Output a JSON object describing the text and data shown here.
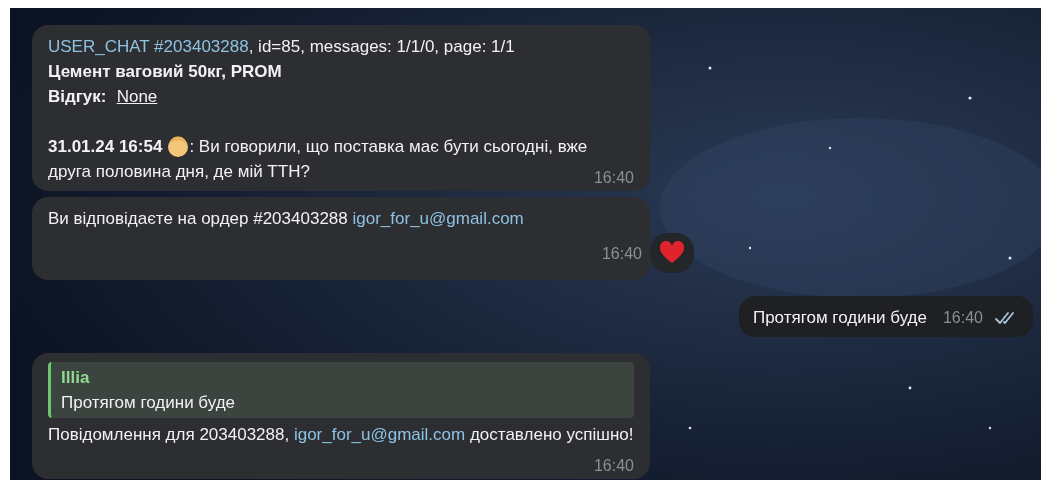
{
  "messages": [
    {
      "kind": "incoming",
      "blocks": [
        [
          [
            {
              "kind": "link",
              "text": "USER_CHAT #203403288"
            },
            {
              "kind": "text",
              "text": ", id=85, messages: 1/1/0, page: 1/1"
            }
          ],
          [
            {
              "kind": "bold",
              "text": "Цемент ваговий 50кг, PROM"
            }
          ],
          [
            {
              "kind": "bold",
              "text": "Відгук:"
            },
            {
              "kind": "underline",
              "text": "None"
            }
          ]
        ],
        [
          [
            {
              "kind": "bold",
              "text": "31.01.24 16:54"
            },
            {
              "kind": "emoji"
            },
            {
              "kind": "text",
              "text": ": Ви говорили, що поставка має бути сьогодні, вже друга половина дня, де мій ТТН?"
            }
          ]
        ]
      ],
      "time": "16:40",
      "reacted": false
    },
    {
      "kind": "incoming",
      "blocks": [
        [
          [
            {
              "kind": "text",
              "text": "Ви відповідаєте на ордер #203403288 "
            },
            {
              "kind": "link",
              "text": "igor_for_u@gmail.com"
            }
          ]
        ]
      ],
      "time": "16:40",
      "reacted": true
    },
    {
      "kind": "outgoing",
      "blocks": [
        [
          [
            {
              "kind": "text",
              "text": "Протягом години буде"
            }
          ]
        ]
      ],
      "time": "16:40",
      "read": true,
      "reacted": false
    },
    {
      "kind": "incoming",
      "reply": {
        "author": "Illia",
        "text": "Протягом години буде"
      },
      "blocks": [
        [
          [
            {
              "kind": "text",
              "text": "Повідомлення для 203403288, "
            },
            {
              "kind": "link",
              "text": "igor_for_u@gmail.com"
            },
            {
              "kind": "text",
              "text": " доставлено успішно!"
            }
          ]
        ]
      ],
      "time": "16:40",
      "reacted": false
    }
  ]
}
